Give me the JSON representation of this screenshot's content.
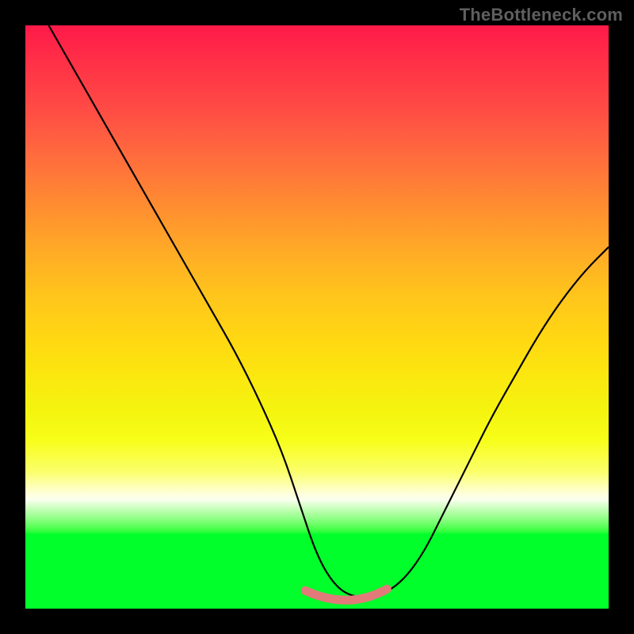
{
  "watermark": "TheBottleneck.com",
  "colors": {
    "black": "#000000",
    "curve_stroke": "#000000",
    "highlight": "#e17a79",
    "watermark": "#5f5f5f"
  },
  "chart_data": {
    "type": "line",
    "title": "",
    "xlabel": "",
    "ylabel": "",
    "xlim": [
      0,
      100
    ],
    "ylim": [
      0,
      100
    ],
    "grid": false,
    "legend": false,
    "series": [
      {
        "name": "bottleneck-curve",
        "x": [
          4,
          8,
          12,
          16,
          20,
          24,
          28,
          32,
          36,
          40,
          44,
          47,
          50,
          53,
          56,
          60,
          64,
          68,
          72,
          76,
          80,
          84,
          88,
          92,
          96,
          100
        ],
        "y": [
          100,
          93,
          86,
          79,
          72,
          65,
          58,
          51,
          44,
          36,
          27,
          18,
          9,
          4,
          2,
          2,
          4,
          9,
          17,
          25,
          33,
          40,
          47,
          53,
          58,
          62
        ]
      }
    ],
    "highlight": {
      "name": "trough-highlight",
      "x_range": [
        48,
        62
      ],
      "y": 2
    },
    "background": {
      "type": "vertical-gradient",
      "stops": [
        {
          "pct": 0,
          "color": "#ff1948"
        },
        {
          "pct": 22,
          "color": "#ff6a3e"
        },
        {
          "pct": 46,
          "color": "#ffc41c"
        },
        {
          "pct": 66,
          "color": "#f4f40f"
        },
        {
          "pct": 80,
          "color": "#fdffd0"
        },
        {
          "pct": 87,
          "color": "#00ff2b"
        },
        {
          "pct": 100,
          "color": "#00ff2b"
        }
      ]
    }
  }
}
